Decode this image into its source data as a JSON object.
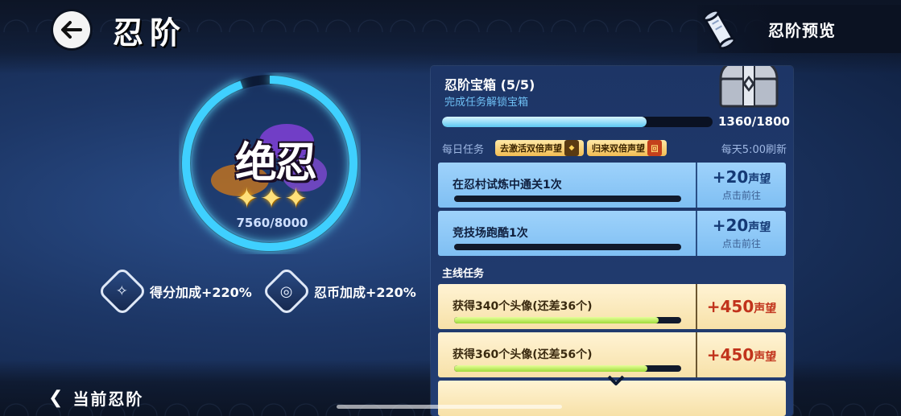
{
  "header": {
    "title": "忍阶",
    "preview_label": "忍阶预览"
  },
  "rank": {
    "name": "绝忍",
    "stars": 3,
    "progress_text": "7560/8000",
    "progress_fraction": 0.945
  },
  "bonuses": [
    {
      "icon": "score-bonus-icon",
      "label": "得分加成+220%"
    },
    {
      "icon": "coin-bonus-icon",
      "label": "忍币加成+220%"
    }
  ],
  "footer": {
    "current_rank_label": "当前忍阶"
  },
  "chest": {
    "title": "忍阶宝箱 (5/5)",
    "subtitle": "完成任务解锁宝箱",
    "count_text": "1360/1800",
    "progress_fraction": 0.756
  },
  "daily": {
    "label": "每日任务",
    "reset_text": "每天5:00刷新",
    "pills": [
      {
        "text": "去激活双倍声望"
      },
      {
        "text": "归来双倍声望"
      }
    ],
    "tasks": [
      {
        "name": "在忍村试炼中通关1次",
        "reward": "+20",
        "unit": "声望",
        "action": "点击前往",
        "progress_fraction": 0
      },
      {
        "name": "竞技场跑酷1次",
        "reward": "+20",
        "unit": "声望",
        "action": "点击前往",
        "progress_fraction": 0
      }
    ]
  },
  "main": {
    "label": "主线任务",
    "tasks": [
      {
        "name": "获得340个头像(还差36个)",
        "reward": "+450",
        "unit": "声望",
        "progress_fraction": 0.9
      },
      {
        "name": "获得360个头像(还差56个)",
        "reward": "+450",
        "unit": "声望",
        "progress_fraction": 0.85
      }
    ]
  },
  "colors": {
    "accent_cyan": "#3fd0ff",
    "daily_card": "#8fc8f8",
    "main_card": "#fbebc0",
    "reward_red": "#c1331c"
  }
}
